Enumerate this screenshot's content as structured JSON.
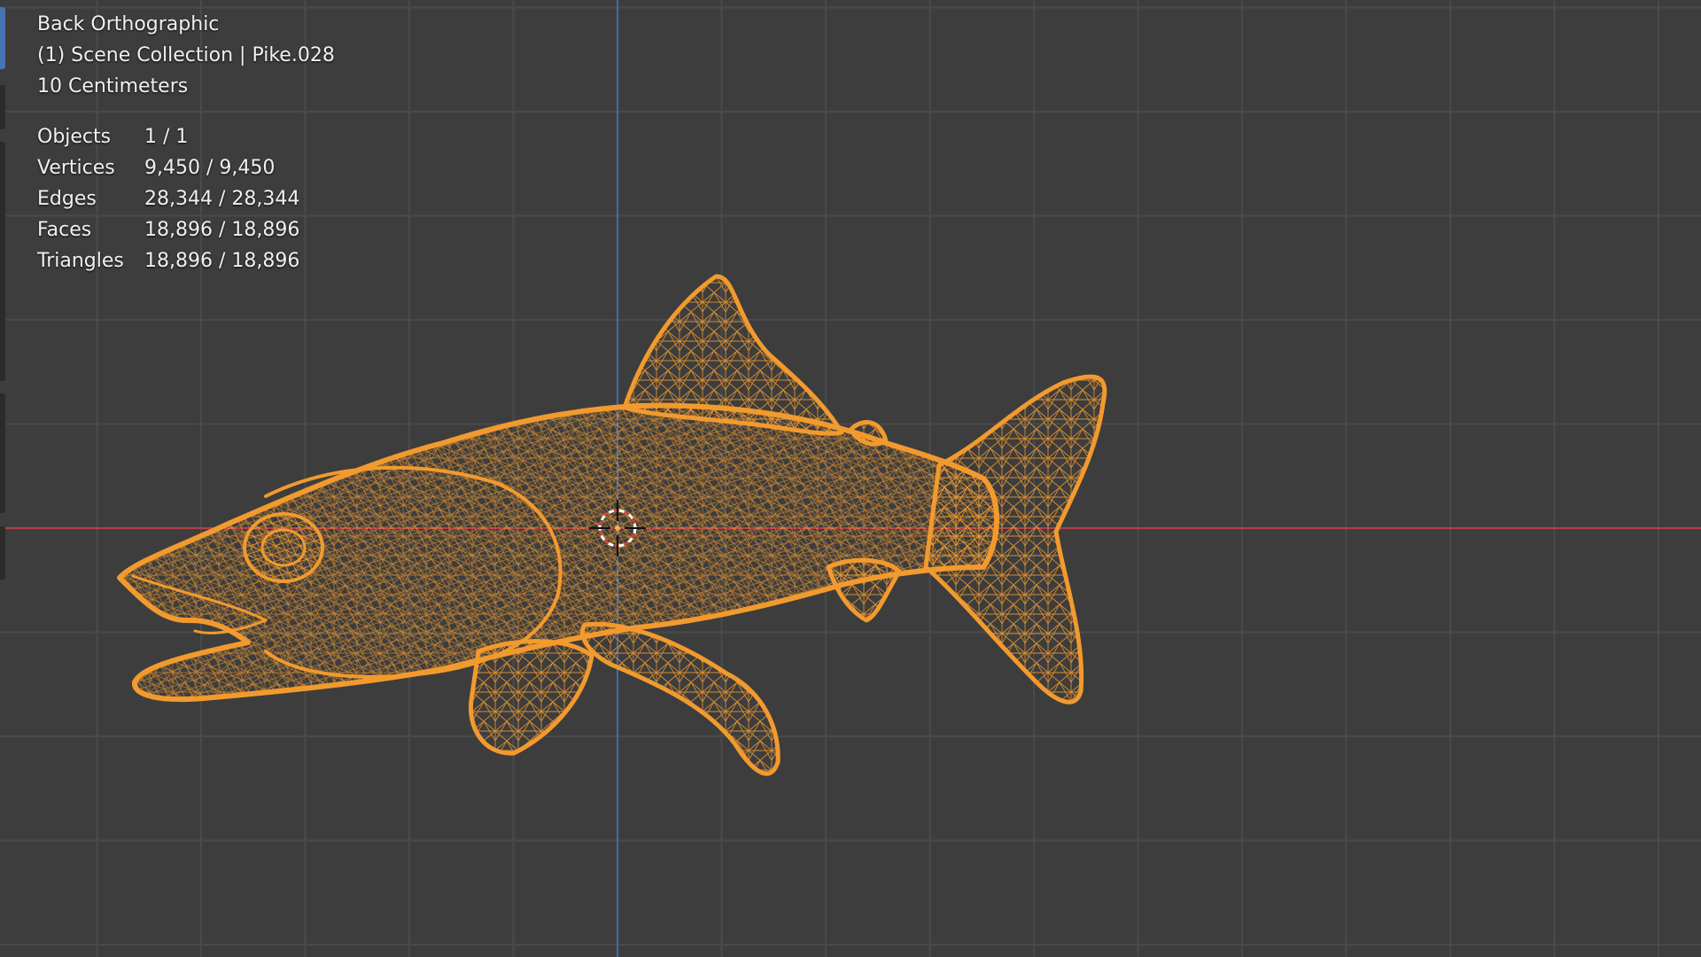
{
  "viewport": {
    "view_name": "Back Orthographic",
    "collection_info": "(1) Scene Collection | Pike.028",
    "grid_scale": "10 Centimeters",
    "statistics": [
      {
        "label": "Objects",
        "value": "1 / 1"
      },
      {
        "label": "Vertices",
        "value": "9,450 / 9,450"
      },
      {
        "label": "Edges",
        "value": "28,344 / 28,344"
      },
      {
        "label": "Faces",
        "value": "18,896 / 18,896"
      },
      {
        "label": "Triangles",
        "value": "18,896 / 18,896"
      }
    ],
    "colors": {
      "background": "#3d3d3d",
      "grid_line": "#4a4a4a",
      "x_axis": "#b3404c",
      "z_axis": "#3f6ea8",
      "selection_wireframe": "#f29a2e",
      "active_tool": "#4772b3"
    },
    "selected_object_icon": "fish-wireframe-icon",
    "cursor_icon": "3d-cursor-icon"
  }
}
